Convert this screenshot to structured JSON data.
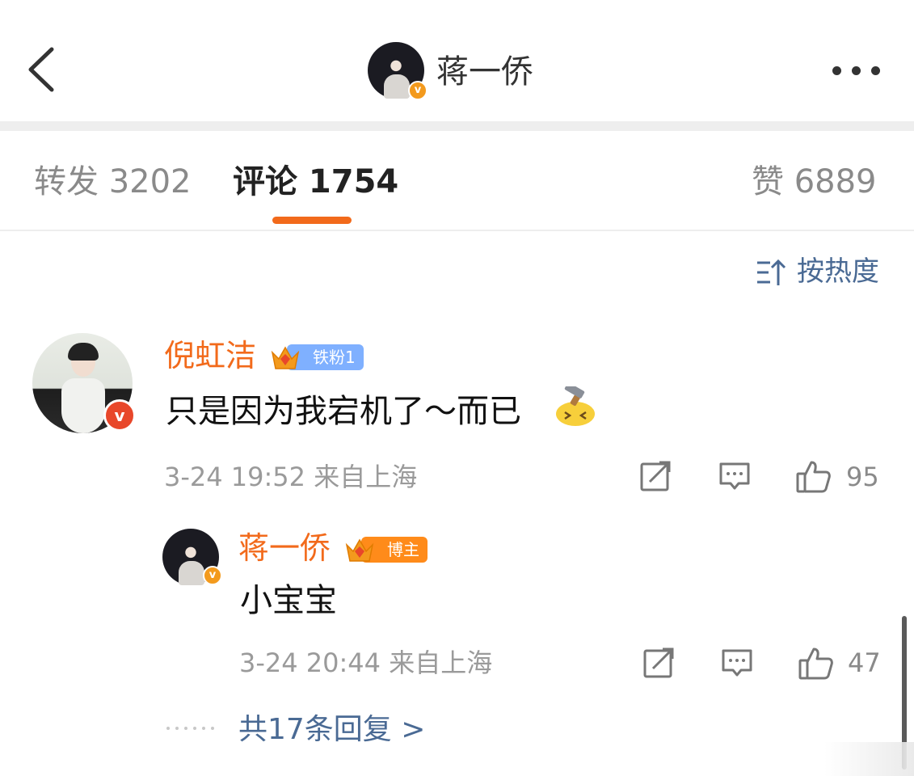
{
  "header": {
    "title": "蒋一侨",
    "verified_mark": "v"
  },
  "tabs": {
    "repost": "转发 3202",
    "comment": "评论 1754",
    "like": "赞 6889"
  },
  "sort": {
    "label": "按热度",
    "link_color": "#4a6a94"
  },
  "comment": {
    "author": "倪虹洁",
    "verified_mark": "v",
    "fan_badge": "铁粉1",
    "text": "只是因为我宕机了～而已",
    "emoji": "hammer-knock-emoji",
    "meta": "3-24 19:52 来自上海",
    "likes": "95"
  },
  "reply": {
    "author": "蒋一侨",
    "verified_mark": "v",
    "host_badge": "博主",
    "text": "小宝宝",
    "meta": "3-24 20:44 来自上海",
    "likes": "47"
  },
  "more_replies": "共17条回复 >",
  "colors": {
    "accent": "#f26a1b",
    "verified": "#f39a1d",
    "fan_badge": "#7fb0ff",
    "host_badge": "#ff8b1a"
  }
}
